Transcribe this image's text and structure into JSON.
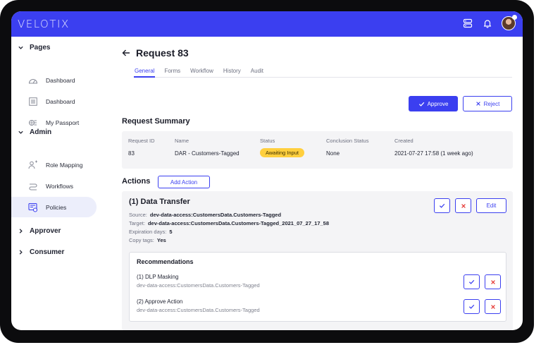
{
  "app": {
    "logo": "VELOTIX"
  },
  "header_icons": {
    "server": "server-icon",
    "bell": "bell-icon",
    "avatar": "user-avatar"
  },
  "sidebar": {
    "sections": [
      {
        "label": "Pages",
        "items": [
          {
            "label": "Dashboard",
            "icon": "gauge-icon"
          },
          {
            "label": "Dashboard",
            "icon": "list-icon"
          },
          {
            "label": "My Passport",
            "icon": "passport-icon"
          }
        ]
      },
      {
        "label": "Admin",
        "items": [
          {
            "label": "Role Mapping",
            "icon": "role-mapping-icon"
          },
          {
            "label": "Workflows",
            "icon": "workflow-icon"
          },
          {
            "label": "Policies",
            "icon": "policy-icon"
          }
        ]
      },
      {
        "label": "Approver",
        "items": []
      },
      {
        "label": "Consumer",
        "items": []
      }
    ],
    "active_item": "Policies"
  },
  "page": {
    "title": "Request 83",
    "tabs": [
      "General",
      "Forms",
      "Workflow",
      "History",
      "Audit"
    ],
    "active_tab": "General",
    "approve_label": "Approve",
    "reject_label": "Reject"
  },
  "summary": {
    "title": "Request Summary",
    "headers": [
      "Request ID",
      "Name",
      "Status",
      "Conclusion Status",
      "Created"
    ],
    "values": [
      "83",
      "DAR - Customers-Tagged",
      "Awaiting Input",
      "None",
      "2021-07-27 17:58 (1 week ago)"
    ]
  },
  "actions": {
    "title": "Actions",
    "add_label": "Add Action",
    "item": {
      "title": "(1) Data Transfer",
      "source_label": "Source:",
      "source": "dev-data-access:CustomersData.Customers-Tagged",
      "target_label": "Target:",
      "target": "dev-data-access:CustomersData.Customers-Tagged_2021_07_27_17_58",
      "expiration_label": "Expiration days:",
      "expiration": "5",
      "copy_tags_label": "Copy tags:",
      "copy_tags": "Yes",
      "edit_label": "Edit"
    },
    "recommendations": {
      "title": "Recommendations",
      "items": [
        {
          "name": "(1) DLP Masking",
          "source": "dev-data-access:CustomersData.Customers-Tagged"
        },
        {
          "name": "(2) Approve Action",
          "source": "dev-data-access:CustomersData.Customers-Tagged"
        }
      ]
    }
  },
  "colors": {
    "accent": "#3b3ff0",
    "badge": "#ffcf3e",
    "reject": "#e53935",
    "card_bg": "#f4f4f6"
  }
}
